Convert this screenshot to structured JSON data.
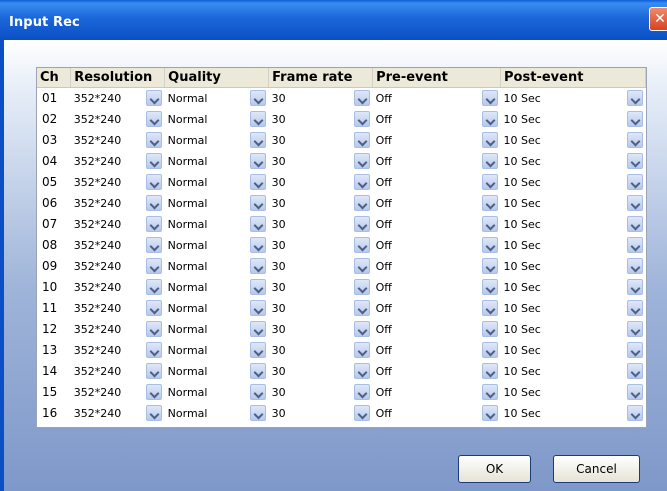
{
  "window": {
    "title": "Input Rec",
    "close_symbol": "✕"
  },
  "columns": [
    "Ch",
    "Resolution",
    "Quality",
    "Frame rate",
    "Pre-event",
    "Post-event"
  ],
  "rows": [
    {
      "ch": "01",
      "resolution": "352*240",
      "quality": "Normal",
      "frame_rate": "30",
      "pre_event": "Off",
      "post_event": "10 Sec"
    },
    {
      "ch": "02",
      "resolution": "352*240",
      "quality": "Normal",
      "frame_rate": "30",
      "pre_event": "Off",
      "post_event": "10 Sec"
    },
    {
      "ch": "03",
      "resolution": "352*240",
      "quality": "Normal",
      "frame_rate": "30",
      "pre_event": "Off",
      "post_event": "10 Sec"
    },
    {
      "ch": "04",
      "resolution": "352*240",
      "quality": "Normal",
      "frame_rate": "30",
      "pre_event": "Off",
      "post_event": "10 Sec"
    },
    {
      "ch": "05",
      "resolution": "352*240",
      "quality": "Normal",
      "frame_rate": "30",
      "pre_event": "Off",
      "post_event": "10 Sec"
    },
    {
      "ch": "06",
      "resolution": "352*240",
      "quality": "Normal",
      "frame_rate": "30",
      "pre_event": "Off",
      "post_event": "10 Sec"
    },
    {
      "ch": "07",
      "resolution": "352*240",
      "quality": "Normal",
      "frame_rate": "30",
      "pre_event": "Off",
      "post_event": "10 Sec"
    },
    {
      "ch": "08",
      "resolution": "352*240",
      "quality": "Normal",
      "frame_rate": "30",
      "pre_event": "Off",
      "post_event": "10 Sec"
    },
    {
      "ch": "09",
      "resolution": "352*240",
      "quality": "Normal",
      "frame_rate": "30",
      "pre_event": "Off",
      "post_event": "10 Sec"
    },
    {
      "ch": "10",
      "resolution": "352*240",
      "quality": "Normal",
      "frame_rate": "30",
      "pre_event": "Off",
      "post_event": "10 Sec"
    },
    {
      "ch": "11",
      "resolution": "352*240",
      "quality": "Normal",
      "frame_rate": "30",
      "pre_event": "Off",
      "post_event": "10 Sec"
    },
    {
      "ch": "12",
      "resolution": "352*240",
      "quality": "Normal",
      "frame_rate": "30",
      "pre_event": "Off",
      "post_event": "10 Sec"
    },
    {
      "ch": "13",
      "resolution": "352*240",
      "quality": "Normal",
      "frame_rate": "30",
      "pre_event": "Off",
      "post_event": "10 Sec"
    },
    {
      "ch": "14",
      "resolution": "352*240",
      "quality": "Normal",
      "frame_rate": "30",
      "pre_event": "Off",
      "post_event": "10 Sec"
    },
    {
      "ch": "15",
      "resolution": "352*240",
      "quality": "Normal",
      "frame_rate": "30",
      "pre_event": "Off",
      "post_event": "10 Sec"
    },
    {
      "ch": "16",
      "resolution": "352*240",
      "quality": "Normal",
      "frame_rate": "30",
      "pre_event": "Off",
      "post_event": "10 Sec"
    }
  ],
  "buttons": {
    "ok": "OK",
    "cancel": "Cancel"
  },
  "icons": {
    "dropdown": "chevron-down-icon",
    "close": "close-icon"
  },
  "colors": {
    "titlebar": "#0b4fc6",
    "close": "#d8421f",
    "header_bg": "#ece9d8"
  }
}
